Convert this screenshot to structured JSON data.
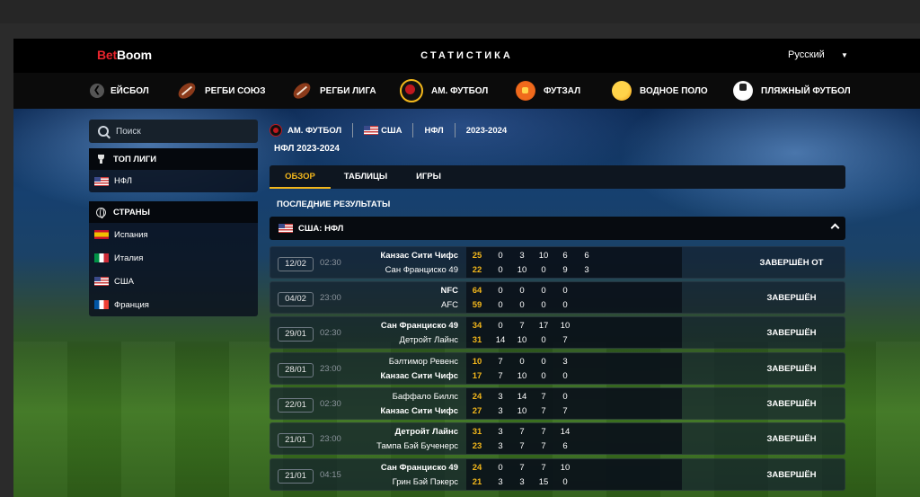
{
  "header": {
    "logo_part1": "Bet",
    "logo_part2": "Boom",
    "title": "СТАТИСТИКА",
    "language": "Русский",
    "language_arrow": "▼"
  },
  "sports_nav": {
    "prev_arrow": "❮",
    "items": [
      {
        "label": "ЕЙСБОЛ",
        "icon": "baseball-icon"
      },
      {
        "label": "РЕГБИ СОЮЗ",
        "icon": "rugby-ball-icon"
      },
      {
        "label": "РЕГБИ ЛИГА",
        "icon": "rugby-ball-icon"
      },
      {
        "label": "АМ. ФУТБОЛ",
        "icon": "american-football-icon",
        "active": true
      },
      {
        "label": "ФУТЗАЛ",
        "icon": "futsal-ball-icon"
      },
      {
        "label": "ВОДНОЕ ПОЛО",
        "icon": "water-polo-ball-icon"
      },
      {
        "label": "ПЛЯЖНЫЙ ФУТБОЛ",
        "icon": "beach-soccer-ball-icon"
      }
    ]
  },
  "sidebar": {
    "search_placeholder": "Поиск",
    "top_leagues": {
      "title": "ТОП ЛИГИ",
      "items": [
        {
          "label": "НФЛ",
          "flag": "us"
        }
      ]
    },
    "countries": {
      "title": "СТРАНЫ",
      "items": [
        {
          "label": "Испания",
          "flag": "es"
        },
        {
          "label": "Италия",
          "flag": "it"
        },
        {
          "label": "США",
          "flag": "us"
        },
        {
          "label": "Франция",
          "flag": "fr"
        }
      ]
    }
  },
  "breadcrumb": {
    "sport": "АМ. ФУТБОЛ",
    "country": "США",
    "league": "НФЛ",
    "season": "2023-2024"
  },
  "league_title": "НФЛ 2023-2024",
  "tabs": [
    {
      "label": "ОБЗОР",
      "active": true
    },
    {
      "label": "ТАБЛИЦЫ"
    },
    {
      "label": "ИГРЫ"
    }
  ],
  "section_title": "ПОСЛЕДНИЕ РЕЗУЛЬТАТЫ",
  "group": {
    "label": "США: НФЛ"
  },
  "colors": {
    "accent": "#f3b71b",
    "brand_red": "#e8242c"
  },
  "matches": [
    {
      "date": "12/02",
      "time": "02:30",
      "status": "ЗАВЕРШЁН ОТ",
      "winner": 1,
      "team1": "Канзас Сити Чифс",
      "team2": "Сан Франциско 49",
      "s1": [
        "25",
        "0",
        "3",
        "10",
        "6",
        "6"
      ],
      "s2": [
        "22",
        "0",
        "10",
        "0",
        "9",
        "3"
      ]
    },
    {
      "date": "04/02",
      "time": "23:00",
      "status": "ЗАВЕРШЁН",
      "winner": 1,
      "team1": "NFC",
      "team2": "AFC",
      "s1": [
        "64",
        "0",
        "0",
        "0",
        "0"
      ],
      "s2": [
        "59",
        "0",
        "0",
        "0",
        "0"
      ]
    },
    {
      "date": "29/01",
      "time": "02:30",
      "status": "ЗАВЕРШЁН",
      "winner": 1,
      "team1": "Сан Франциско 49",
      "team2": "Детройт Лайнс",
      "s1": [
        "34",
        "0",
        "7",
        "17",
        "10"
      ],
      "s2": [
        "31",
        "14",
        "10",
        "0",
        "7"
      ]
    },
    {
      "date": "28/01",
      "time": "23:00",
      "status": "ЗАВЕРШЁН",
      "winner": 2,
      "team1": "Бэлтимор Ревенс",
      "team2": "Канзас Сити Чифс",
      "s1": [
        "10",
        "7",
        "0",
        "0",
        "3"
      ],
      "s2": [
        "17",
        "7",
        "10",
        "0",
        "0"
      ]
    },
    {
      "date": "22/01",
      "time": "02:30",
      "status": "ЗАВЕРШЁН",
      "winner": 2,
      "team1": "Баффало Биллс",
      "team2": "Канзас Сити Чифс",
      "s1": [
        "24",
        "3",
        "14",
        "7",
        "0"
      ],
      "s2": [
        "27",
        "3",
        "10",
        "7",
        "7"
      ]
    },
    {
      "date": "21/01",
      "time": "23:00",
      "status": "ЗАВЕРШЁН",
      "winner": 1,
      "team1": "Детройт Лайнс",
      "team2": "Тампа Бэй Бученерс",
      "s1": [
        "31",
        "3",
        "7",
        "7",
        "14"
      ],
      "s2": [
        "23",
        "3",
        "7",
        "7",
        "6"
      ]
    },
    {
      "date": "21/01",
      "time": "04:15",
      "status": "ЗАВЕРШЁН",
      "winner": 1,
      "team1": "Сан Франциско 49",
      "team2": "Грин Бэй Пэкерс",
      "s1": [
        "24",
        "0",
        "7",
        "7",
        "10"
      ],
      "s2": [
        "21",
        "3",
        "3",
        "15",
        "0"
      ]
    }
  ]
}
